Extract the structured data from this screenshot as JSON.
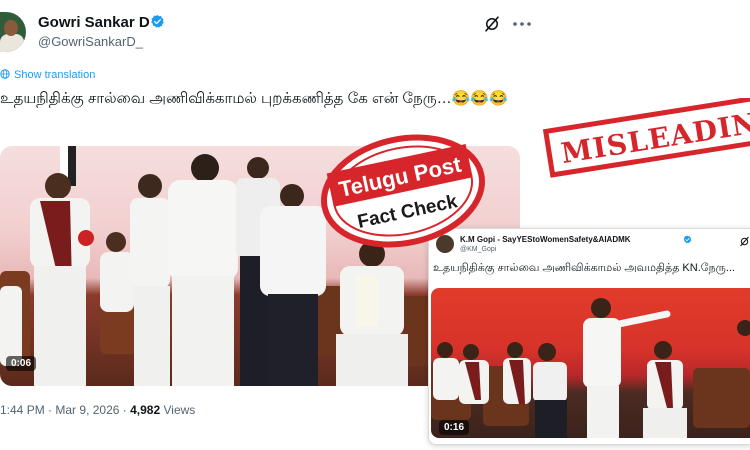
{
  "tweet": {
    "author_name": "Gowri Sankar D",
    "author_handle": "@GowriSankarD_",
    "show_translation": "Show translation",
    "text": "உதயநிதிக்கு சால்வை அணிவிக்காமல் புறக்கணித்த கே என் நேரு…😂😂😂",
    "video_duration": "0:06",
    "time": "1:44 PM",
    "date": "Mar 9, 2026",
    "separator": "·",
    "views_count": "4,982",
    "views_label": "Views"
  },
  "quoted_tweet": {
    "author_name": "K.M Gopi - SayYEStoWomenSafety&AIADMK",
    "author_handle": "@KM_Gopi",
    "text": "உதயநிதிக்கு சால்வை அணிவிக்காமல் அவமதித்த KN.நேரு...",
    "video_duration": "0:16"
  },
  "stamps": {
    "brand_line1": "Telugu Post",
    "brand_line2": "Fact Check",
    "verdict": "MISLEADING"
  },
  "icons": {
    "verified": "verified-badge-icon",
    "grok": "grok-icon",
    "more": "more-icon",
    "globe": "globe-icon"
  },
  "colors": {
    "verified_blue": "#1d9bf0",
    "stamp_red": "#d7262b",
    "handle_gray": "#536471"
  }
}
